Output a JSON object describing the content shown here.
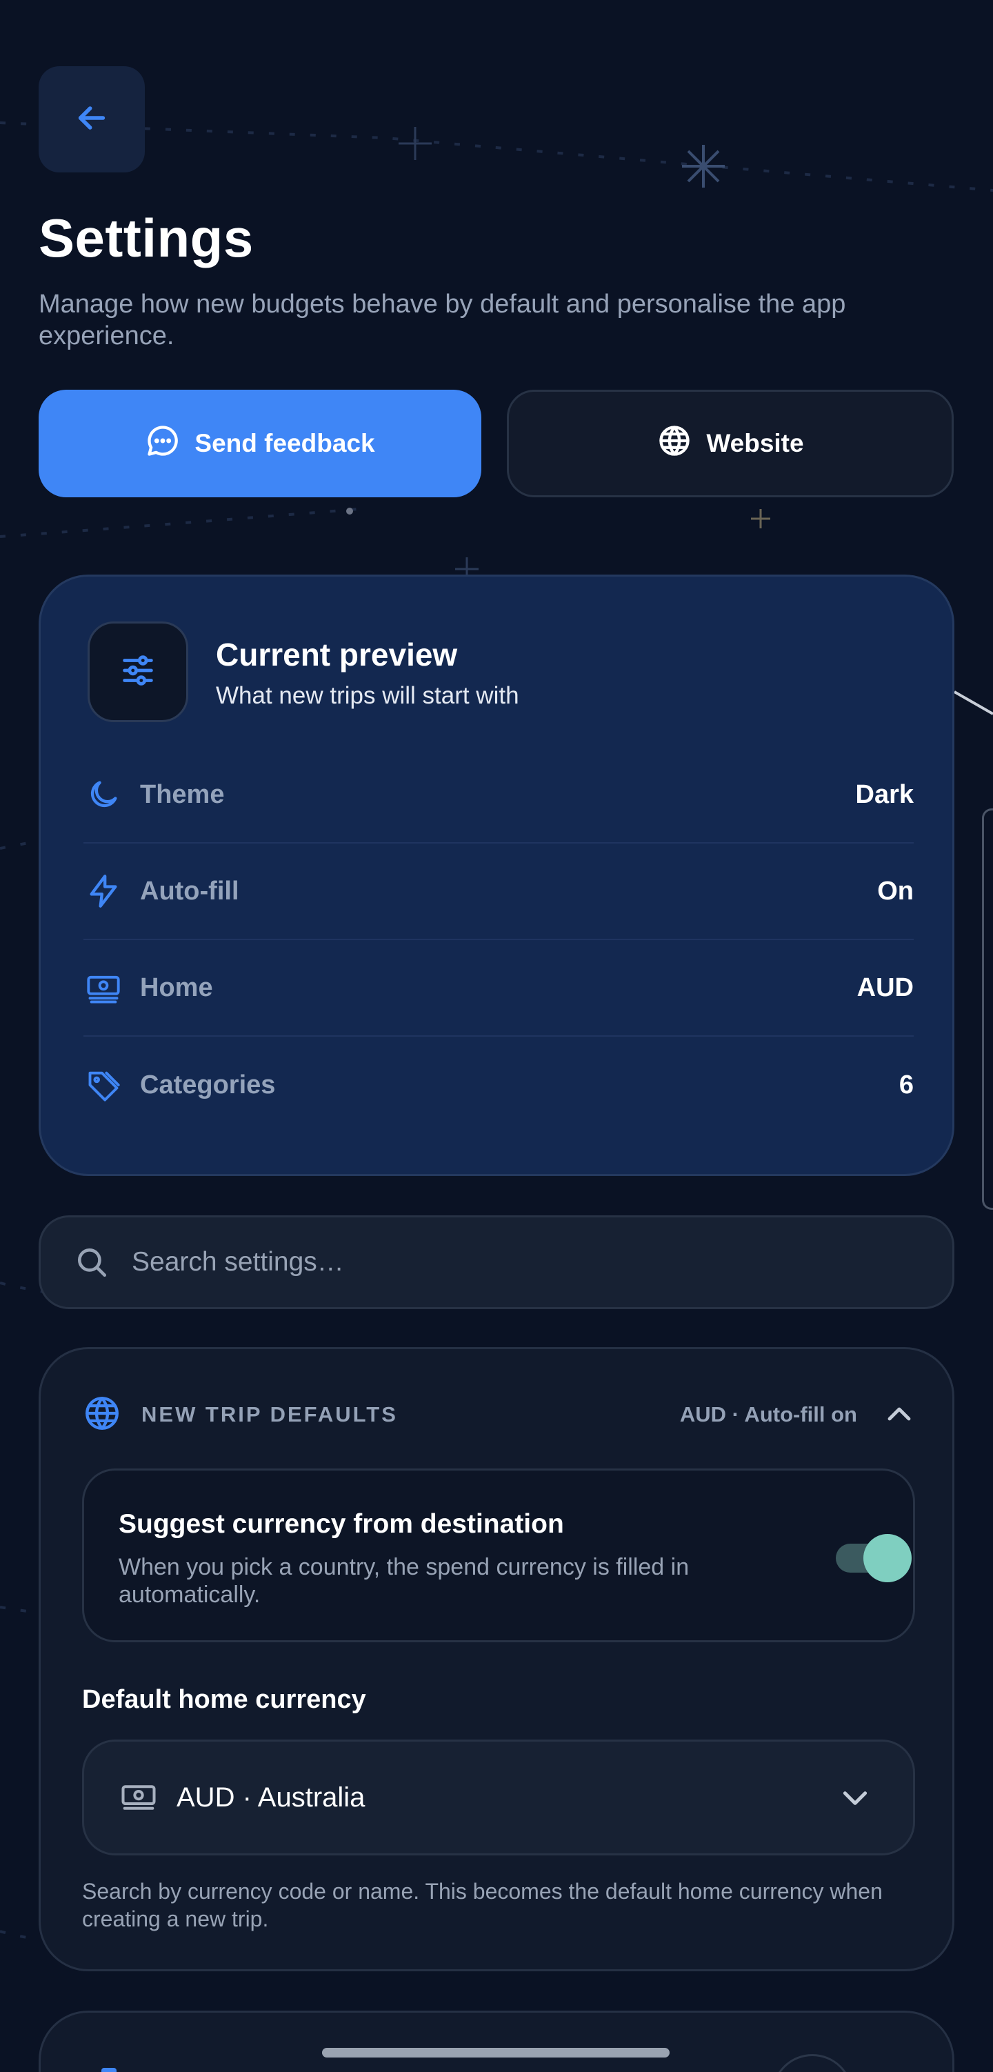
{
  "header": {
    "back_label": "Back",
    "title": "Settings",
    "subtitle": "Manage how new budgets behave by default and personalise the app experience."
  },
  "actions": {
    "feedback_label": "Send feedback",
    "website_label": "Website"
  },
  "preview": {
    "title": "Current preview",
    "subtitle": "What new trips will start with",
    "rows": [
      {
        "icon": "moon-icon",
        "label": "Theme",
        "value": "Dark"
      },
      {
        "icon": "lightning-icon",
        "label": "Auto-fill",
        "value": "On"
      },
      {
        "icon": "banknote-icon",
        "label": "Home",
        "value": "AUD"
      },
      {
        "icon": "tag-icon",
        "label": "Categories",
        "value": "6"
      }
    ]
  },
  "search": {
    "placeholder": "Search settings…",
    "value": ""
  },
  "defaults": {
    "title": "NEW TRIP DEFAULTS",
    "meta": "AUD · Auto-fill on",
    "expanded": true,
    "suggest": {
      "title": "Suggest currency from destination",
      "description": "When you pick a country, the spend currency is filled in automatically.",
      "enabled": true
    },
    "home_currency": {
      "label": "Default home currency",
      "value": "AUD · Australia",
      "help": "Search by currency code or name. This becomes the default home currency when creating a new trip."
    }
  },
  "colors": {
    "background": "#0a1224",
    "accent": "#3f86f6",
    "preview_card": "#132850",
    "toggle_on": "#7fcfc0"
  }
}
